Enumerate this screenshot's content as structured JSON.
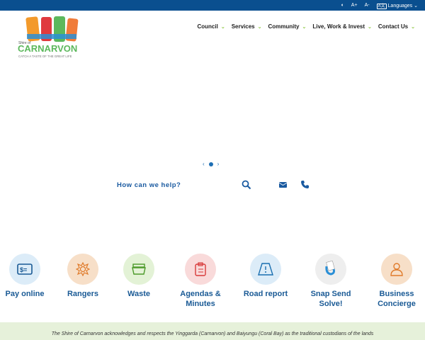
{
  "topbar": {
    "contrast_icon": "contrast-icon",
    "font_increase": "A+",
    "font_decrease": "A-",
    "lang_icon": "A文",
    "languages": "Languages"
  },
  "logo": {
    "small": "Shire of",
    "name": "CARNARVON",
    "tagline": "CATCH A TASTE OF THE GREAT LIFE"
  },
  "nav": [
    {
      "label": "Council"
    },
    {
      "label": "Services"
    },
    {
      "label": "Community"
    },
    {
      "label": "Live, Work & Invest"
    },
    {
      "label": "Contact Us"
    }
  ],
  "slider": {
    "prev": "‹",
    "next": "›",
    "slides": 1,
    "active": 1
  },
  "help": {
    "label": "How can we help?"
  },
  "tiles": [
    {
      "label": "Pay online",
      "icon": "payment-icon",
      "color": "#dcecf8"
    },
    {
      "label": "Rangers",
      "icon": "sun-badge-icon",
      "color": "#f7dfc8"
    },
    {
      "label": "Waste",
      "icon": "bin-icon",
      "color": "#e3f2d6"
    },
    {
      "label": "Agendas & Minutes",
      "icon": "clipboard-icon",
      "color": "#f9dada"
    },
    {
      "label": "Road report",
      "icon": "road-icon",
      "color": "#dcecf8"
    },
    {
      "label": "Snap Send Solve!",
      "icon": "snap-send-solve-icon",
      "color": "#eeeeee"
    },
    {
      "label": "Business Concierge",
      "icon": "concierge-icon",
      "color": "#f7dfc8"
    }
  ],
  "acknowledgement": "The Shire of Carnarvon acknowledges and respects the Yinggarda (Carnarvon) and Baiyungu (Coral Bay) as the traditional custodians of the lands"
}
